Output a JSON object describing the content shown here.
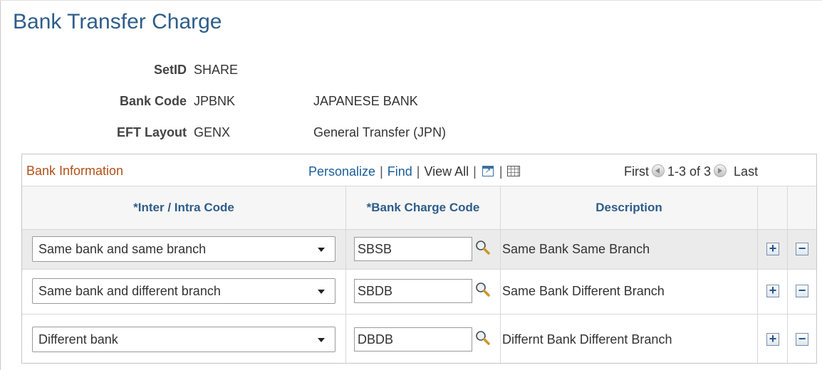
{
  "page": {
    "title": "Bank Transfer Charge"
  },
  "header": {
    "setid_label": "SetID",
    "setid_value": "SHARE",
    "bank_code_label": "Bank Code",
    "bank_code_value": "JPBNK",
    "bank_name": "JAPANESE BANK",
    "eft_layout_label": "EFT Layout",
    "eft_layout_value": "GENX",
    "eft_layout_desc": "General Transfer (JPN)"
  },
  "grid": {
    "title": "Bank Information",
    "nav": {
      "personalize": "Personalize",
      "find": "Find",
      "view_all": "View All",
      "first": "First",
      "range": "1-3 of 3",
      "last": "Last"
    },
    "columns": {
      "inter_intra": "*Inter / Intra Code",
      "bank_charge": "*Bank Charge Code",
      "description": "Description"
    },
    "rows": [
      {
        "inter_intra": "Same bank and same branch",
        "bank_charge_code": "SBSB",
        "description": "Same Bank Same Branch"
      },
      {
        "inter_intra": "Same bank and different branch",
        "bank_charge_code": "SBDB",
        "description": "Same Bank Different Branch"
      },
      {
        "inter_intra": "Different bank",
        "bank_charge_code": "DBDB",
        "description": "Differnt Bank Different Branch"
      }
    ],
    "row_highlight_color": "#ebebeb",
    "add_symbol": "+",
    "delete_symbol": "−"
  },
  "colors": {
    "title": "#2e5d8a",
    "grid_title": "#b24f16",
    "link": "#1a5e9a"
  }
}
